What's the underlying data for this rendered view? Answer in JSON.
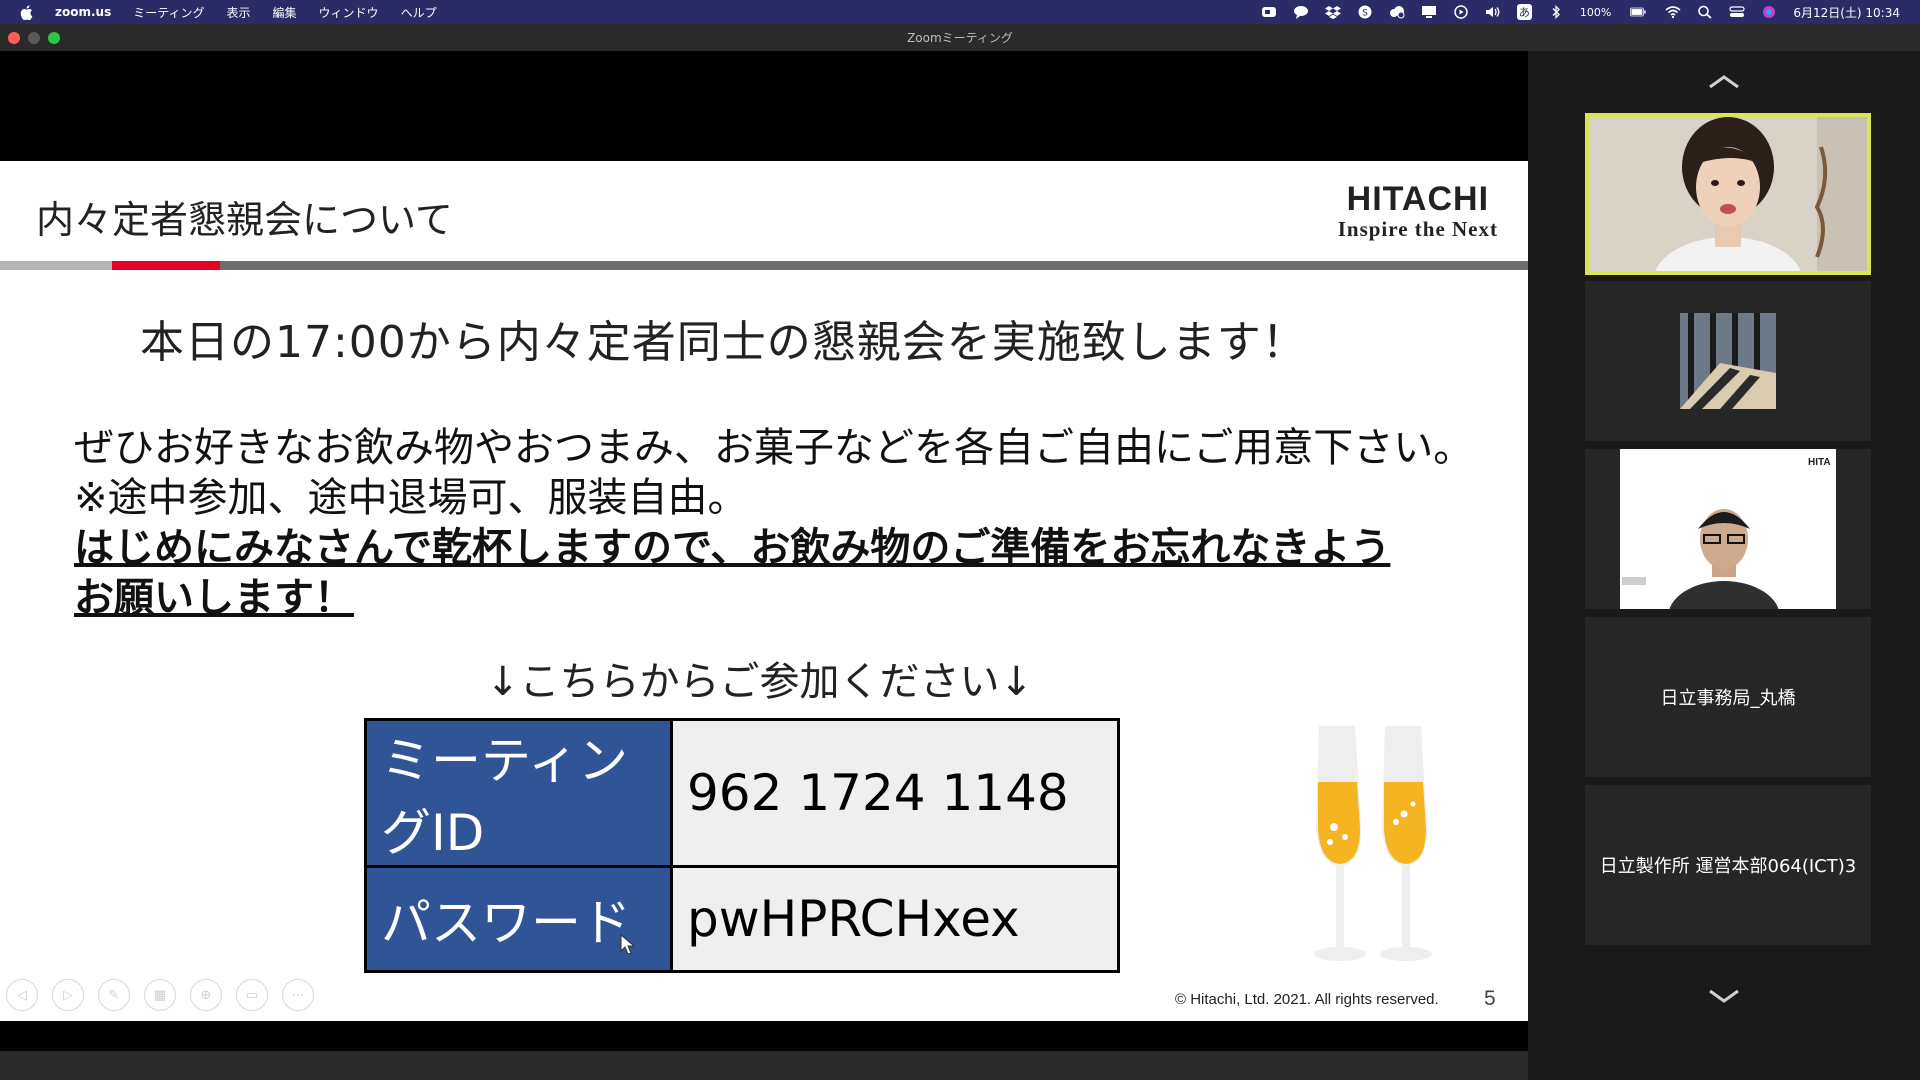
{
  "menubar": {
    "app_name": "zoom.us",
    "items": [
      "ミーティング",
      "表示",
      "編集",
      "ウィンドウ",
      "ヘルプ"
    ],
    "status_icons": [
      "zoom-icon",
      "chat-icon",
      "dropbox-icon",
      "skype-icon",
      "creative-cloud-icon",
      "display-icon",
      "play-icon",
      "volume-icon"
    ],
    "input_method": "あ",
    "battery": "100%",
    "datetime": "6月12日(土) 10:34"
  },
  "window": {
    "title": "Zoomミーティング"
  },
  "slide": {
    "title": "内々定者懇親会について",
    "logo_brand": "HITACHI",
    "logo_tagline": "Inspire the Next",
    "headline": "本日の17:00から内々定者同士の懇親会を実施致します！",
    "body_lines": [
      "ぜひお好きなお飲み物やおつまみ、お菓子などを各自ご自由にご用意下さい。",
      "※途中参加、途中退場可、服装自由。",
      "はじめにみなさんで乾杯しますので、お飲み物のご準備をお忘れなきよう",
      "お願いします！"
    ],
    "join_text": "↓こちらからご参加ください↓",
    "table": [
      {
        "label": "ミーティングID",
        "value": "962 1724 1148"
      },
      {
        "label": "パスワード",
        "value": "pwHPRCHxex"
      }
    ],
    "copyright": "© Hitachi, Ltd. 2021. All rights reserved.",
    "page_number": "5",
    "colors": {
      "accent": "#e60027",
      "table_label_bg": "#2f5597",
      "table_value_bg": "#efefef"
    }
  },
  "participants": [
    {
      "type": "video",
      "label": ""
    },
    {
      "type": "video",
      "label": ""
    },
    {
      "type": "video",
      "label": ""
    },
    {
      "type": "name",
      "label": "日立事務局_丸橋"
    },
    {
      "type": "name",
      "label": "日立製作所 運営本部064(ICT)3"
    }
  ]
}
